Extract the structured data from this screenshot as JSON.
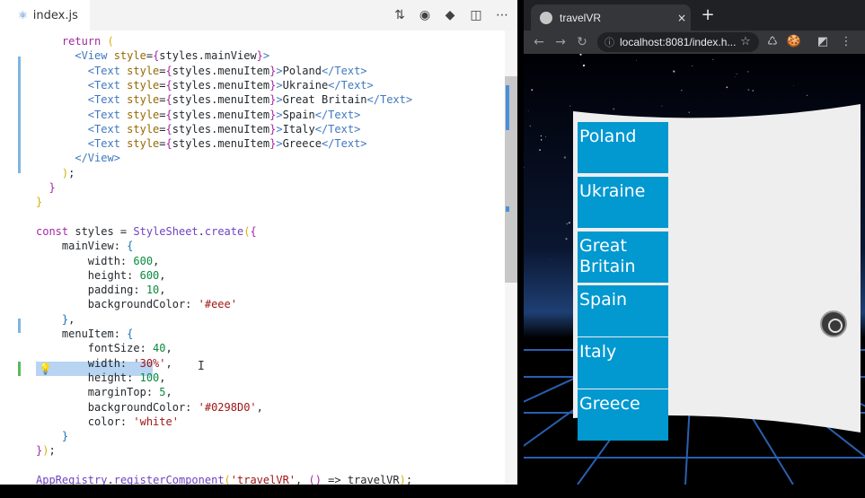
{
  "editor": {
    "tab": {
      "filename": "index.js",
      "icon": "react-file-icon"
    },
    "toolbar_icons": [
      "compare-changes-icon",
      "open-preview-icon",
      "git-icon",
      "split-editor-icon",
      "more-actions-icon"
    ],
    "lines": [
      [
        [
          "kw",
          "    return "
        ],
        [
          "br1",
          "("
        ]
      ],
      [
        [
          "tag",
          "      <View "
        ],
        [
          "attr",
          "style"
        ],
        [
          "plain",
          "="
        ],
        [
          "br2",
          "{"
        ],
        [
          "prop",
          "styles.mainView"
        ],
        [
          "br2",
          "}"
        ],
        [
          "tag",
          ">"
        ]
      ],
      [
        [
          "tag",
          "        <Text "
        ],
        [
          "attr",
          "style"
        ],
        [
          "plain",
          "="
        ],
        [
          "br2",
          "{"
        ],
        [
          "prop",
          "styles.menuItem"
        ],
        [
          "br2",
          "}"
        ],
        [
          "tag",
          ">"
        ],
        [
          "plain",
          "Poland"
        ],
        [
          "tag",
          "</Text>"
        ]
      ],
      [
        [
          "tag",
          "        <Text "
        ],
        [
          "attr",
          "style"
        ],
        [
          "plain",
          "="
        ],
        [
          "br2",
          "{"
        ],
        [
          "prop",
          "styles.menuItem"
        ],
        [
          "br2",
          "}"
        ],
        [
          "tag",
          ">"
        ],
        [
          "plain",
          "Ukraine"
        ],
        [
          "tag",
          "</Text>"
        ]
      ],
      [
        [
          "tag",
          "        <Text "
        ],
        [
          "attr",
          "style"
        ],
        [
          "plain",
          "="
        ],
        [
          "br2",
          "{"
        ],
        [
          "prop",
          "styles.menuItem"
        ],
        [
          "br2",
          "}"
        ],
        [
          "tag",
          ">"
        ],
        [
          "plain",
          "Great Britain"
        ],
        [
          "tag",
          "</Text>"
        ]
      ],
      [
        [
          "tag",
          "        <Text "
        ],
        [
          "attr",
          "style"
        ],
        [
          "plain",
          "="
        ],
        [
          "br2",
          "{"
        ],
        [
          "prop",
          "styles.menuItem"
        ],
        [
          "br2",
          "}"
        ],
        [
          "tag",
          ">"
        ],
        [
          "plain",
          "Spain"
        ],
        [
          "tag",
          "</Text>"
        ]
      ],
      [
        [
          "tag",
          "        <Text "
        ],
        [
          "attr",
          "style"
        ],
        [
          "plain",
          "="
        ],
        [
          "br2",
          "{"
        ],
        [
          "prop",
          "styles.menuItem"
        ],
        [
          "br2",
          "}"
        ],
        [
          "tag",
          ">"
        ],
        [
          "plain",
          "Italy"
        ],
        [
          "tag",
          "</Text>"
        ]
      ],
      [
        [
          "tag",
          "        <Text "
        ],
        [
          "attr",
          "style"
        ],
        [
          "plain",
          "="
        ],
        [
          "br2",
          "{"
        ],
        [
          "prop",
          "styles.menuItem"
        ],
        [
          "br2",
          "}"
        ],
        [
          "tag",
          ">"
        ],
        [
          "plain",
          "Greece"
        ],
        [
          "tag",
          "</Text>"
        ]
      ],
      [
        [
          "tag",
          "      </View>"
        ]
      ],
      [
        [
          "br1",
          "    )"
        ],
        [
          "plain",
          ";"
        ]
      ],
      [
        [
          "br2",
          "  }"
        ]
      ],
      [
        [
          "br1",
          "}"
        ]
      ],
      [
        [
          "plain",
          ""
        ]
      ],
      [
        [
          "kw",
          "const "
        ],
        [
          "plain",
          "styles = "
        ],
        [
          "fn",
          "StyleSheet"
        ],
        [
          "plain",
          "."
        ],
        [
          "fn",
          "create"
        ],
        [
          "br1",
          "("
        ],
        [
          "br2",
          "{"
        ]
      ],
      [
        [
          "prop",
          "    mainView: "
        ],
        [
          "br3",
          "{"
        ]
      ],
      [
        [
          "prop",
          "        width: "
        ],
        [
          "num",
          "600"
        ],
        [
          "plain",
          ","
        ]
      ],
      [
        [
          "prop",
          "        height: "
        ],
        [
          "num",
          "600"
        ],
        [
          "plain",
          ","
        ]
      ],
      [
        [
          "prop",
          "        padding: "
        ],
        [
          "num",
          "10"
        ],
        [
          "plain",
          ","
        ]
      ],
      [
        [
          "prop",
          "        backgroundColor: "
        ],
        [
          "str",
          "'#eee'"
        ]
      ],
      [
        [
          "br3",
          "    }"
        ],
        [
          "plain",
          ","
        ]
      ],
      [
        [
          "prop",
          "    menuItem: "
        ],
        [
          "br3",
          "{"
        ]
      ],
      [
        [
          "prop",
          "        fontSize: "
        ],
        [
          "num",
          "40"
        ],
        [
          "plain",
          ","
        ]
      ],
      [
        [
          "prop",
          "        width: "
        ],
        [
          "str",
          "'30%'"
        ],
        [
          "plain",
          ","
        ]
      ],
      [
        [
          "prop",
          "        height: "
        ],
        [
          "num",
          "100"
        ],
        [
          "plain",
          ","
        ]
      ],
      [
        [
          "prop",
          "        marginTop: "
        ],
        [
          "num",
          "5"
        ],
        [
          "plain",
          ","
        ]
      ],
      [
        [
          "prop",
          "        backgroundColor: "
        ],
        [
          "str",
          "'#0298D0'"
        ],
        [
          "plain",
          ","
        ]
      ],
      [
        [
          "prop",
          "        color: "
        ],
        [
          "str",
          "'white'"
        ]
      ],
      [
        [
          "br3",
          "    }"
        ]
      ],
      [
        [
          "br2",
          "}"
        ],
        [
          "br1",
          ")"
        ],
        [
          "plain",
          ";"
        ]
      ],
      [
        [
          "plain",
          ""
        ]
      ],
      [
        [
          "fn",
          "AppRegistry"
        ],
        [
          "plain",
          "."
        ],
        [
          "fn",
          "registerComponent"
        ],
        [
          "br1",
          "("
        ],
        [
          "str",
          "'travelVR'"
        ],
        [
          "plain",
          ", "
        ],
        [
          "br2",
          "()"
        ],
        [
          "plain",
          " => travelVR"
        ],
        [
          "br1",
          ")"
        ],
        [
          "plain",
          ";"
        ]
      ]
    ]
  },
  "browser": {
    "tab_title": "travelVR",
    "new_tab": "+",
    "close": "×",
    "url": "localhost:8081/index.h...",
    "nav": {
      "back": "←",
      "forward": "→",
      "reload": "↻"
    },
    "info_icon": "ⓘ",
    "bookmark_icon": "☆",
    "extensions": [
      "♺",
      "🍪",
      "◩",
      "⋮"
    ]
  },
  "vr": {
    "menu_items": [
      "Poland",
      "Ukraine",
      "Great Britain",
      "Spain",
      "Italy",
      "Greece"
    ],
    "item_color": "#0298D0",
    "panel_color": "#eeeeee",
    "grid_color": "#2a5fb0",
    "sky_color": "#0a1630"
  }
}
